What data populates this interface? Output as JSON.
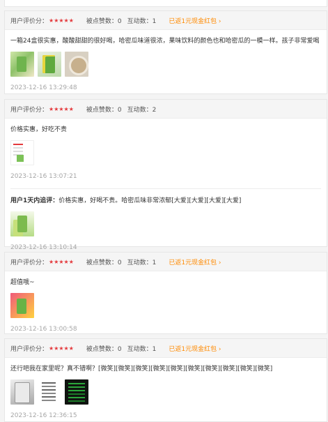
{
  "reviews": [
    {
      "rating_label": "用户评价分：",
      "stars": "★★★★★",
      "likes": "被点赞数：0",
      "interactions": "互动数：1",
      "cashback": "已返1元现金红包 ›",
      "text": "一箱24盒很实惠，酸酸甜甜的很好喝，哈密瓜味道很浓，果味饮料的颜色也和哈密瓜的一模一样。孩子非常爱喝",
      "date": "2023-12-16 13:29:48"
    },
    {
      "rating_label": "用户评价分：",
      "stars": "★★★★★",
      "likes": "被点赞数：0",
      "interactions": "互动数：2",
      "text": "价格实惠，好吃不贵",
      "date": "2023-12-16 13:07:21",
      "followup_title": "用户1天内追评：",
      "followup_text": "价格实惠，好喝不贵。哈密瓜味非常浓郁[大爱][大爱][大爱][大爱]",
      "followup_date": "2023-12-16 13:10:14"
    },
    {
      "rating_label": "用户评价分：",
      "stars": "★★★★★",
      "likes": "被点赞数：0",
      "interactions": "互动数：1",
      "cashback": "已返1元现金红包 ›",
      "text": "超值哦~",
      "date": "2023-12-16 13:00:58"
    },
    {
      "rating_label": "用户评价分：",
      "stars": "★★★★★",
      "likes": "被点赞数：0",
      "interactions": "互动数：1",
      "cashback": "已返1元现金红包 ›",
      "text": "还行吧我在家里呢？真不错啊？[微笑][微笑][微笑][微笑][微笑][微笑][微笑][微笑][微笑][微笑]",
      "date": "2023-12-16 12:36:15"
    }
  ]
}
